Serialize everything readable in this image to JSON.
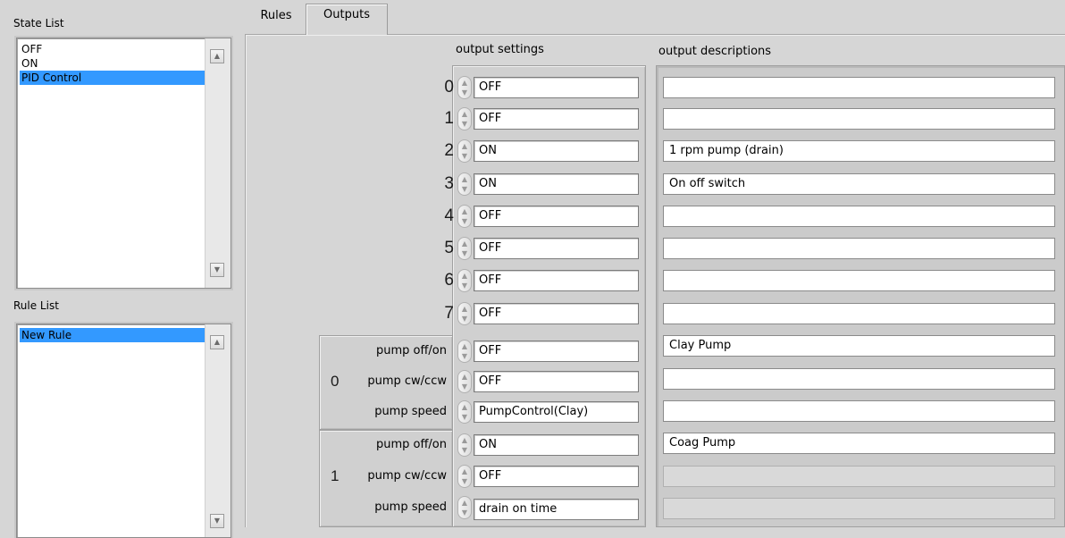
{
  "left": {
    "state_list": {
      "label": "State List",
      "items": [
        "OFF",
        "ON",
        "PID Control"
      ],
      "selected": 2
    },
    "rule_list": {
      "label": "Rule List",
      "items": [
        "New Rule"
      ],
      "selected": 0
    }
  },
  "tabs": [
    {
      "label": "Rules",
      "active": false
    },
    {
      "label": "Outputs",
      "active": true
    }
  ],
  "outputs": {
    "settings_header": "output settings",
    "descriptions_header": "output descriptions",
    "rows": [
      {
        "index": "0",
        "value": "OFF",
        "description": ""
      },
      {
        "index": "1",
        "value": "OFF",
        "description": ""
      },
      {
        "index": "2",
        "value": "ON",
        "description": "1 rpm pump (drain)"
      },
      {
        "index": "3",
        "value": "ON",
        "description": "On off switch"
      },
      {
        "index": "4",
        "value": "OFF",
        "description": ""
      },
      {
        "index": "5",
        "value": "OFF",
        "description": ""
      },
      {
        "index": "6",
        "value": "OFF",
        "description": ""
      },
      {
        "index": "7",
        "value": "OFF",
        "description": ""
      }
    ],
    "pump_groups": [
      {
        "index": "0",
        "rows": [
          {
            "label": "pump off/on",
            "value": "OFF",
            "description": "Clay Pump",
            "disabled": false
          },
          {
            "label": "pump cw/ccw",
            "value": "OFF",
            "description": "",
            "disabled": false
          },
          {
            "label": "pump speed",
            "value": "PumpControl(Clay)",
            "description": "",
            "disabled": false
          }
        ]
      },
      {
        "index": "1",
        "rows": [
          {
            "label": "pump off/on",
            "value": "ON",
            "description": "Coag Pump",
            "disabled": false
          },
          {
            "label": "pump cw/ccw",
            "value": "OFF",
            "description": "",
            "disabled": true
          },
          {
            "label": "pump speed",
            "value": "drain on time",
            "description": "",
            "disabled": true
          }
        ]
      }
    ]
  }
}
